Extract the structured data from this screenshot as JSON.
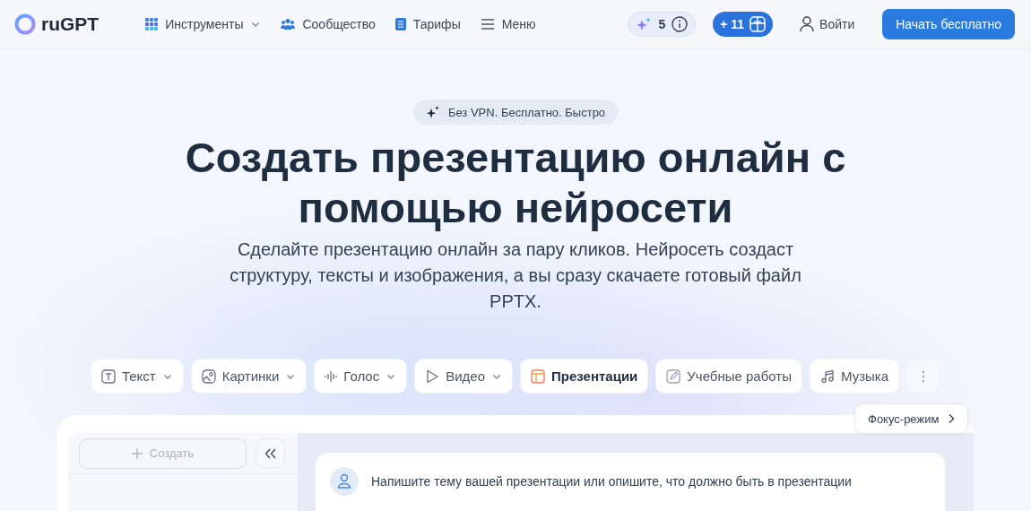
{
  "header": {
    "logo": "ruGPT",
    "nav": [
      {
        "label": "Инструменты",
        "dropdown": true
      },
      {
        "label": "Сообщество",
        "dropdown": false
      },
      {
        "label": "Тарифы",
        "dropdown": false
      },
      {
        "label": "Меню",
        "dropdown": false
      }
    ],
    "credits": "5",
    "bonus": "+ 11",
    "login": "Войти",
    "cta": "Начать бесплатно"
  },
  "hero": {
    "badge": "Без VPN. Бесплатно. Быстро",
    "title": "Создать презентацию онлайн с помощью нейросети",
    "subtitle": "Сделайте презентацию онлайн за пару кликов. Нейросеть создаст структуру, тексты и изображения, а вы сразу скачаете готовый файл PPTX."
  },
  "tools": [
    {
      "label": "Текст",
      "dropdown": true,
      "selected": false
    },
    {
      "label": "Картинки",
      "dropdown": true,
      "selected": false
    },
    {
      "label": "Голос",
      "dropdown": true,
      "selected": false
    },
    {
      "label": "Видео",
      "dropdown": true,
      "selected": false
    },
    {
      "label": "Презентации",
      "dropdown": false,
      "selected": true
    },
    {
      "label": "Учебные работы",
      "dropdown": false,
      "selected": false
    },
    {
      "label": "Музыка",
      "dropdown": false,
      "selected": false
    }
  ],
  "focus_mode": "Фокус-режим",
  "workspace": {
    "create": {
      "label": "Создать",
      "disabled": true
    },
    "prompt": "Напишите тему вашей презентации или опишите, что должно быть в презентации"
  }
}
